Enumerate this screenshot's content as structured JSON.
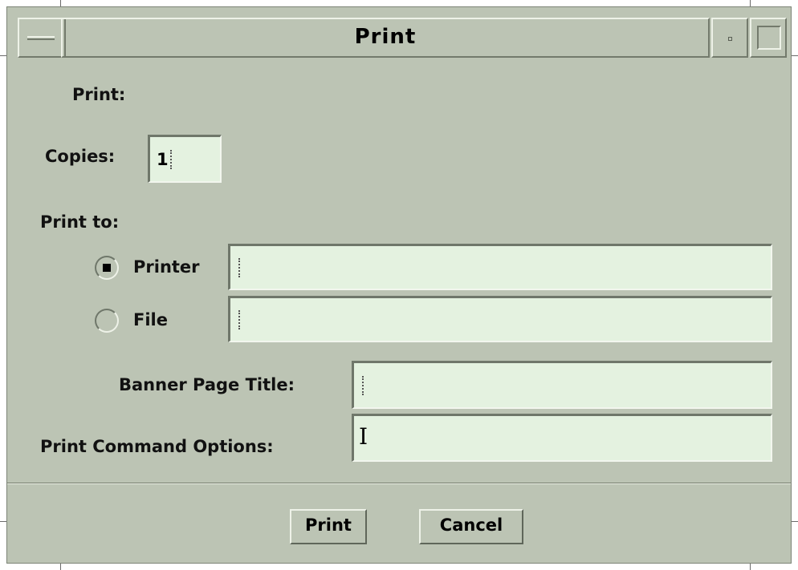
{
  "window": {
    "title": "Print"
  },
  "form": {
    "section_label": "Print:",
    "copies_label": "Copies:",
    "copies_value": "1",
    "print_to_label": "Print to:",
    "printer_label": "Printer",
    "printer_selected": true,
    "printer_value": "",
    "file_label": "File",
    "file_selected": false,
    "file_value": "",
    "banner_label": "Banner Page Title:",
    "banner_value": "",
    "options_label": "Print Command Options:",
    "options_value": ""
  },
  "buttons": {
    "print_label": "Print",
    "cancel_label": "Cancel"
  },
  "colors": {
    "background": "#bcc4b4",
    "field": "#e4f2e0"
  }
}
